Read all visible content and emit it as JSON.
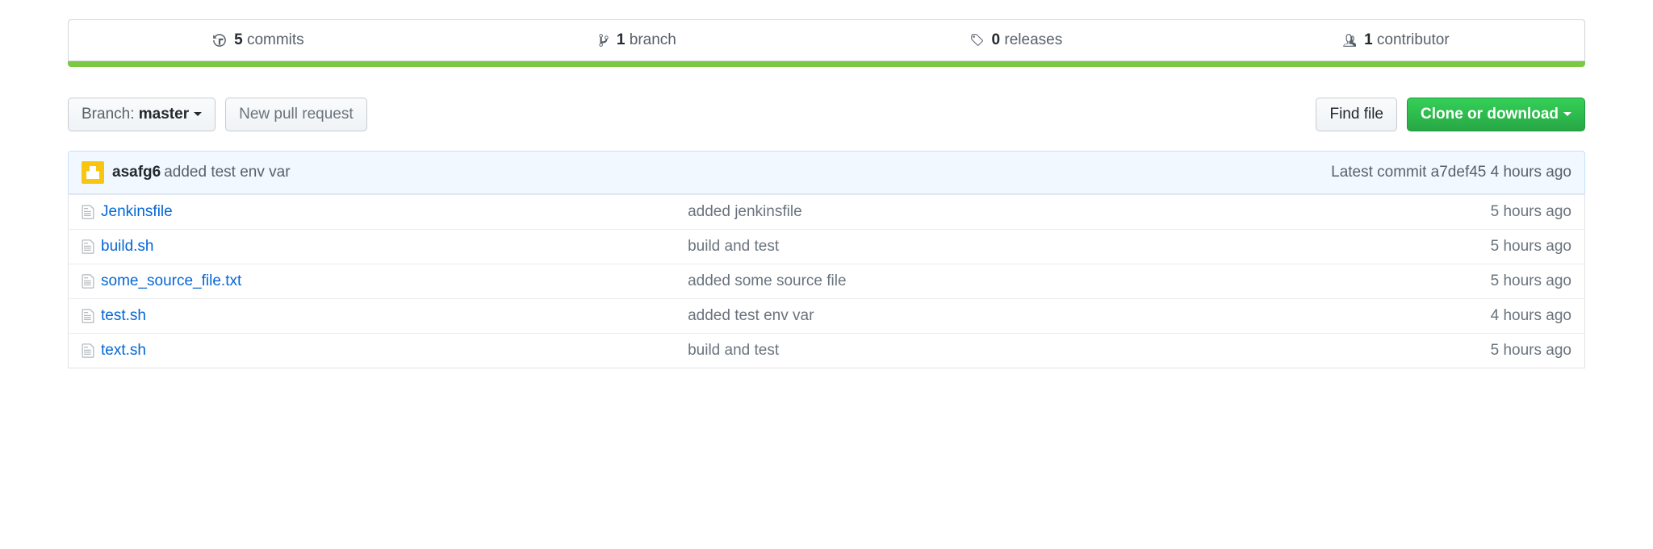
{
  "stats": {
    "commits_count": "5",
    "commits_label": "commits",
    "branches_count": "1",
    "branches_label": "branch",
    "releases_count": "0",
    "releases_label": "releases",
    "contributors_count": "1",
    "contributors_label": "contributor"
  },
  "toolbar": {
    "branch_prefix": "Branch: ",
    "branch_name": "master",
    "new_pr": "New pull request",
    "find_file": "Find file",
    "clone": "Clone or download"
  },
  "latest_commit": {
    "author": "asafg6",
    "message": "added test env var",
    "meta_prefix": "Latest commit ",
    "sha": "a7def45",
    "age": " 4 hours ago"
  },
  "files": [
    {
      "name": "Jenkinsfile",
      "message": "added jenkinsfile",
      "age": "5 hours ago"
    },
    {
      "name": "build.sh",
      "message": "build and test",
      "age": "5 hours ago"
    },
    {
      "name": "some_source_file.txt",
      "message": "added some source file",
      "age": "5 hours ago"
    },
    {
      "name": "test.sh",
      "message": "added test env var",
      "age": "4 hours ago"
    },
    {
      "name": "text.sh",
      "message": "build and test",
      "age": "5 hours ago"
    }
  ]
}
